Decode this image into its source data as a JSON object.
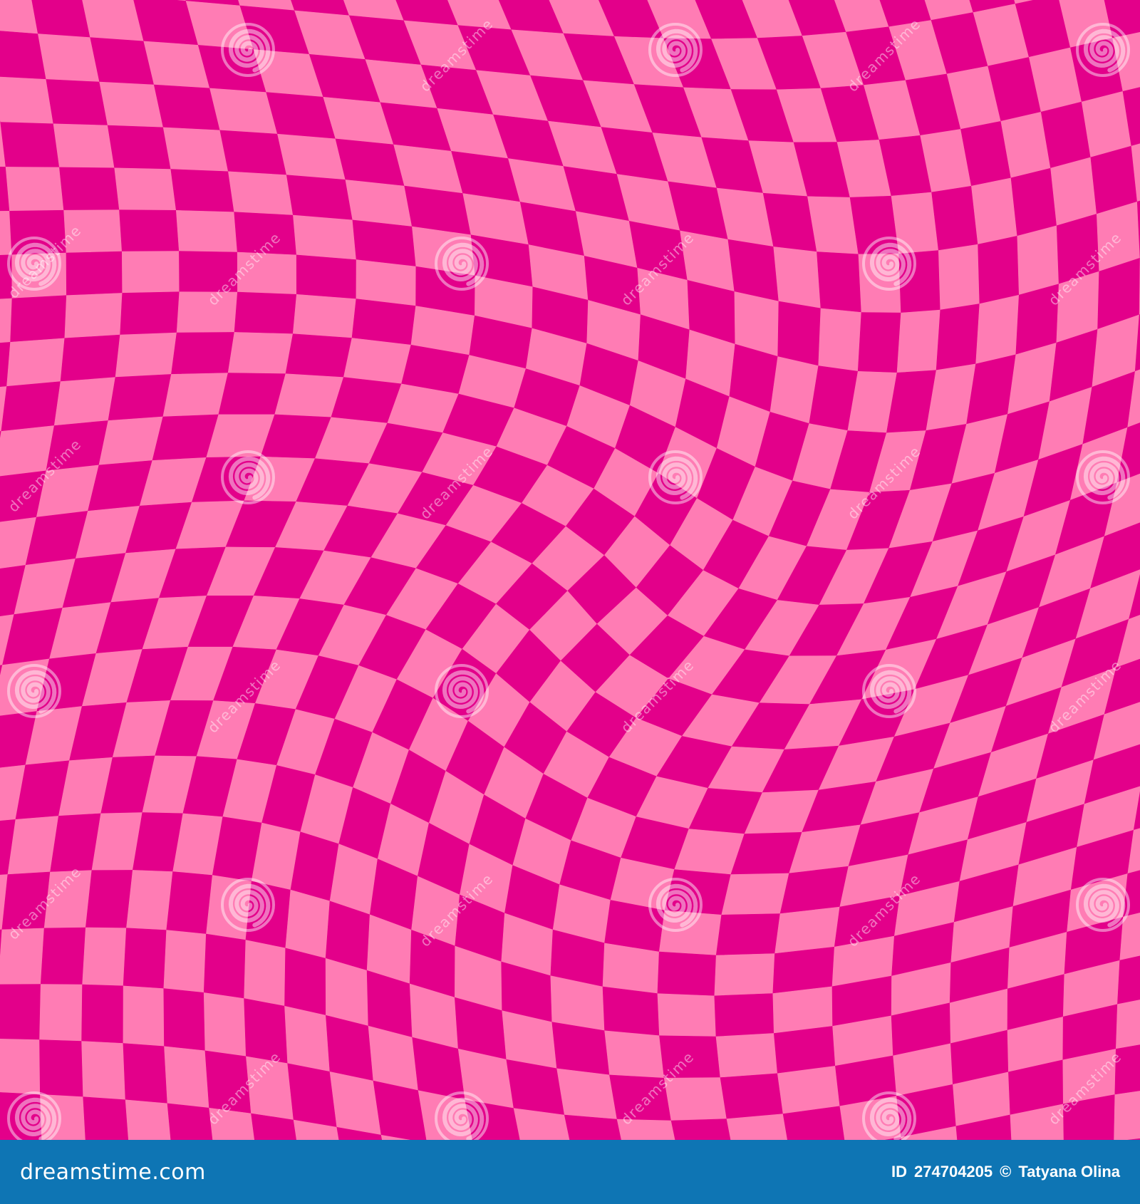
{
  "image": {
    "description": "seamless distorted pink checkerboard pattern",
    "colors": {
      "dark_tile": "#e3008a",
      "light_tile": "#ff7cb4",
      "footer_background": "#0e75b4",
      "footer_text": "#ffffff",
      "watermark": "#ffffff"
    }
  },
  "watermark": {
    "text": "dreamstime",
    "icon": "spiral-icon"
  },
  "footer": {
    "logo_text": "dreamstime.com",
    "id_label": "ID",
    "id_value": "274704205",
    "copyright_symbol": "©",
    "author": "Tatyana Olina"
  }
}
